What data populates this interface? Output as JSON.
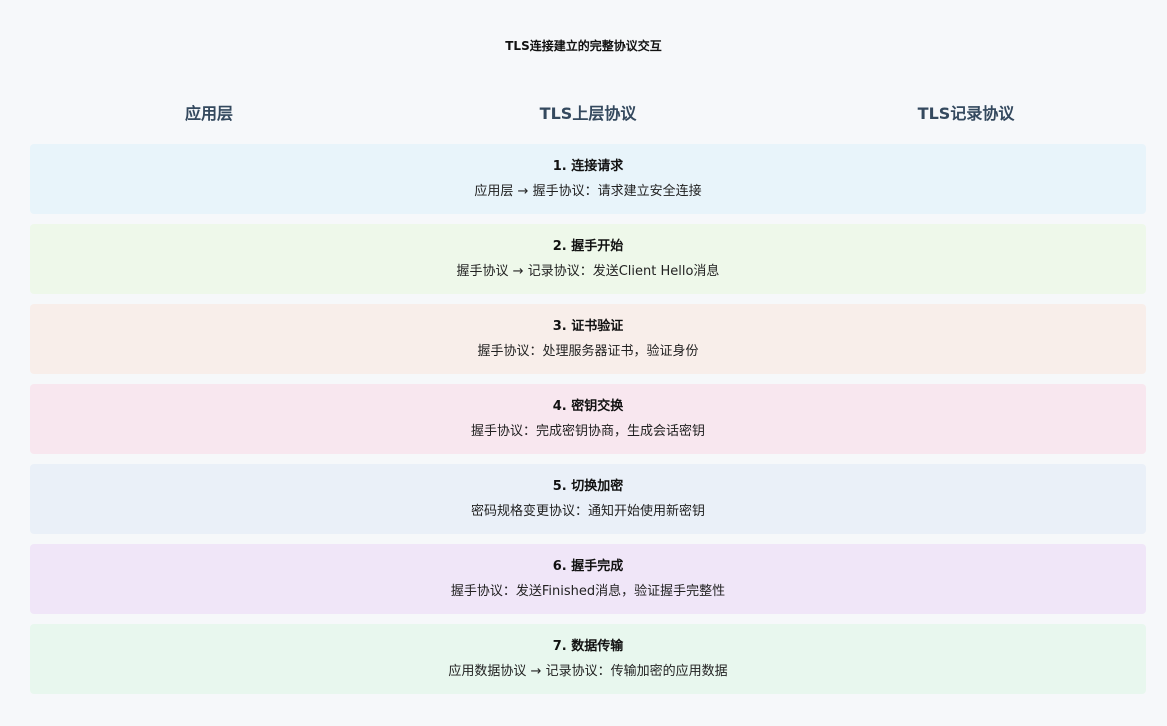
{
  "title": "TLS连接建立的完整协议交互",
  "columns": [
    "应用层",
    "TLS上层协议",
    "TLS记录协议"
  ],
  "steps": [
    {
      "title": "1. 连接请求",
      "desc": "应用层 → 握手协议：请求建立安全连接",
      "color": "#e8f4fa"
    },
    {
      "title": "2. 握手开始",
      "desc": "握手协议 → 记录协议：发送Client Hello消息",
      "color": "#eef8ea"
    },
    {
      "title": "3. 证书验证",
      "desc": "握手协议：处理服务器证书，验证身份",
      "color": "#f8eeea"
    },
    {
      "title": "4. 密钥交换",
      "desc": "握手协议：完成密钥协商，生成会话密钥",
      "color": "#f8e7ef"
    },
    {
      "title": "5. 切换加密",
      "desc": "密码规格变更协议：通知开始使用新密钥",
      "color": "#eaf0f8"
    },
    {
      "title": "6. 握手完成",
      "desc": "握手协议：发送Finished消息，验证握手完整性",
      "color": "#f0e6f8"
    },
    {
      "title": "7. 数据传输",
      "desc": "应用数据协议 → 记录协议：传输加密的应用数据",
      "color": "#e8f7ee"
    }
  ]
}
